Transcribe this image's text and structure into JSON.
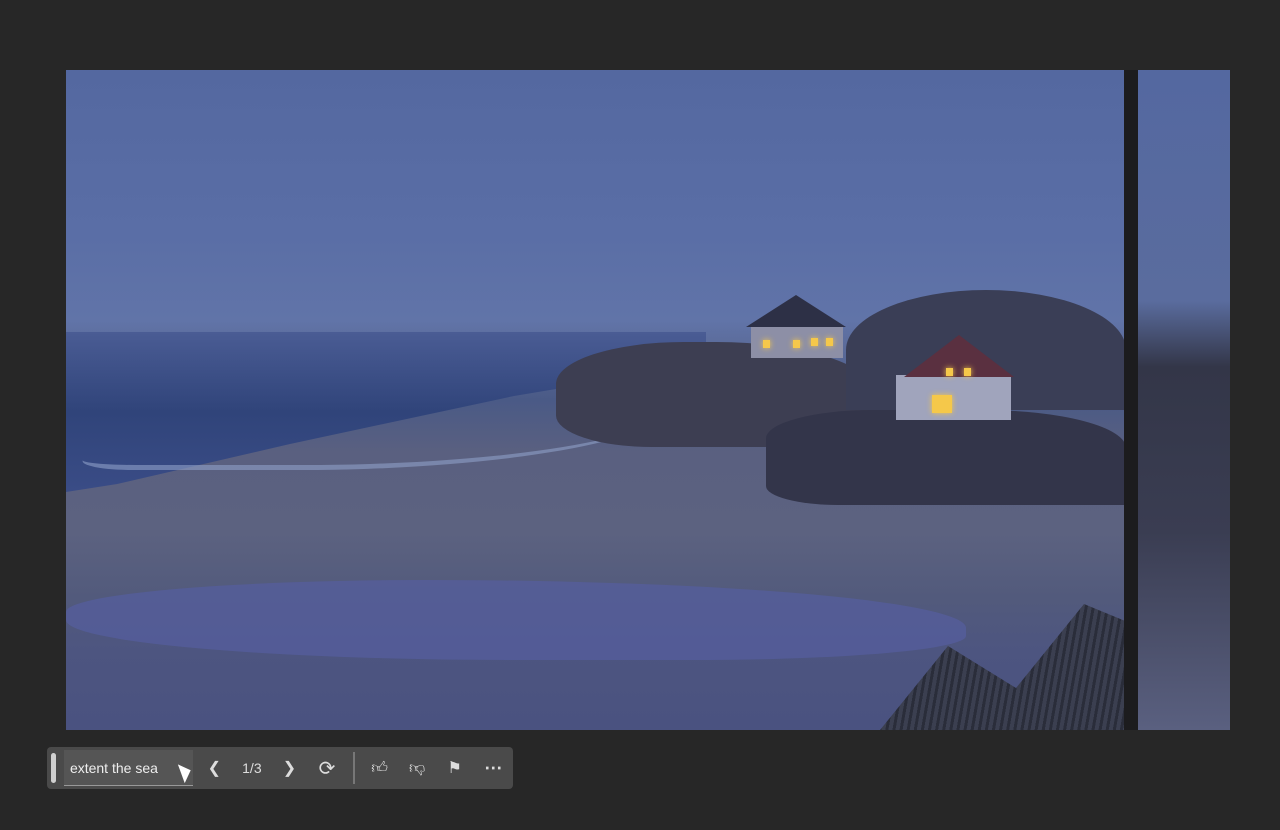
{
  "toolbar": {
    "prompt_text": "extent the sea",
    "page_counter": "1/3",
    "icons": {
      "prev": "chevron-left-icon",
      "next": "chevron-right-icon",
      "regenerate": "refresh-icon",
      "like": "thumbs-up-icon",
      "dislike": "thumbs-down-icon",
      "flag": "flag-icon",
      "more": "more-icon"
    }
  }
}
